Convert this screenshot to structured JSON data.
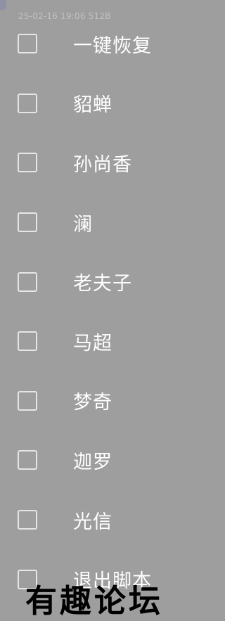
{
  "header": {
    "timestamp": "25-02-16 19:06",
    "size": "512B"
  },
  "menu": {
    "items": [
      {
        "label": "一键恢复",
        "checked": false
      },
      {
        "label": "貂蝉",
        "checked": false
      },
      {
        "label": "孙尚香",
        "checked": false
      },
      {
        "label": "澜",
        "checked": false
      },
      {
        "label": "老夫子",
        "checked": false
      },
      {
        "label": "马超",
        "checked": false
      },
      {
        "label": "梦奇",
        "checked": false
      },
      {
        "label": "迦罗",
        "checked": false
      },
      {
        "label": "光信",
        "checked": false
      },
      {
        "label": "退出脚本",
        "checked": false
      }
    ]
  },
  "watermark": {
    "text": "有趣论坛"
  },
  "colors": {
    "background": "#9e9e9e",
    "text": "#ffffff",
    "checkbox_border": "#e6e6e6",
    "meta_text": "#c2c2c2"
  }
}
